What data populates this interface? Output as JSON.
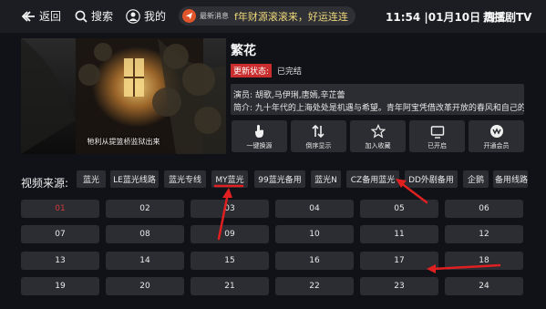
{
  "topbar": {
    "back_label": "返回",
    "search_label": "搜索",
    "profile_label": "我的",
    "news_tag": "最新消息",
    "news_text": "f年财源滚滚来，好运连连",
    "clock": "11:54 |01月10日 周三",
    "brand": "热播剧TV"
  },
  "video": {
    "subtitle": "牠利从提篮桥监狱出来"
  },
  "info": {
    "title": "繁花",
    "status_label": "更新状态:",
    "status_value": "已完结",
    "cast": "演员: 胡歌,马伊琍,唐嫣,辛芷蕾",
    "synopsis": "简介: 九十年代的上海处处是机遇与希望。青年阿宝凭借改革开放的春风和自己的"
  },
  "actions": [
    {
      "label": "一键换源",
      "icon": "touch-icon"
    },
    {
      "label": "倒序显示",
      "icon": "sort-icon"
    },
    {
      "label": "加入收藏",
      "icon": "star-icon"
    },
    {
      "label": "已开启",
      "icon": "tv-icon"
    },
    {
      "label": "开通会员",
      "icon": "vip-icon"
    }
  ],
  "sources": {
    "label": "视频来源:",
    "items": [
      "蓝光",
      "LE蓝光线路",
      "蓝光专线",
      "MY蓝光",
      "99蓝光备用",
      "蓝光N",
      "CZ备用蓝光",
      "DD外剧备用",
      "企鹅",
      "备用线路"
    ],
    "selected": "MY蓝光"
  },
  "episodes": [
    "01",
    "02",
    "03",
    "04",
    "05",
    "06",
    "07",
    "08",
    "09",
    "10",
    "11",
    "12",
    "13",
    "14",
    "15",
    "16",
    "17",
    "18",
    "19",
    "20",
    "21",
    "22",
    "23",
    "24"
  ],
  "current_episode": "01",
  "colors": {
    "accent_red": "#c92d2d",
    "annotation_arrow": "#e02020",
    "news_text": "#f0d97a"
  }
}
